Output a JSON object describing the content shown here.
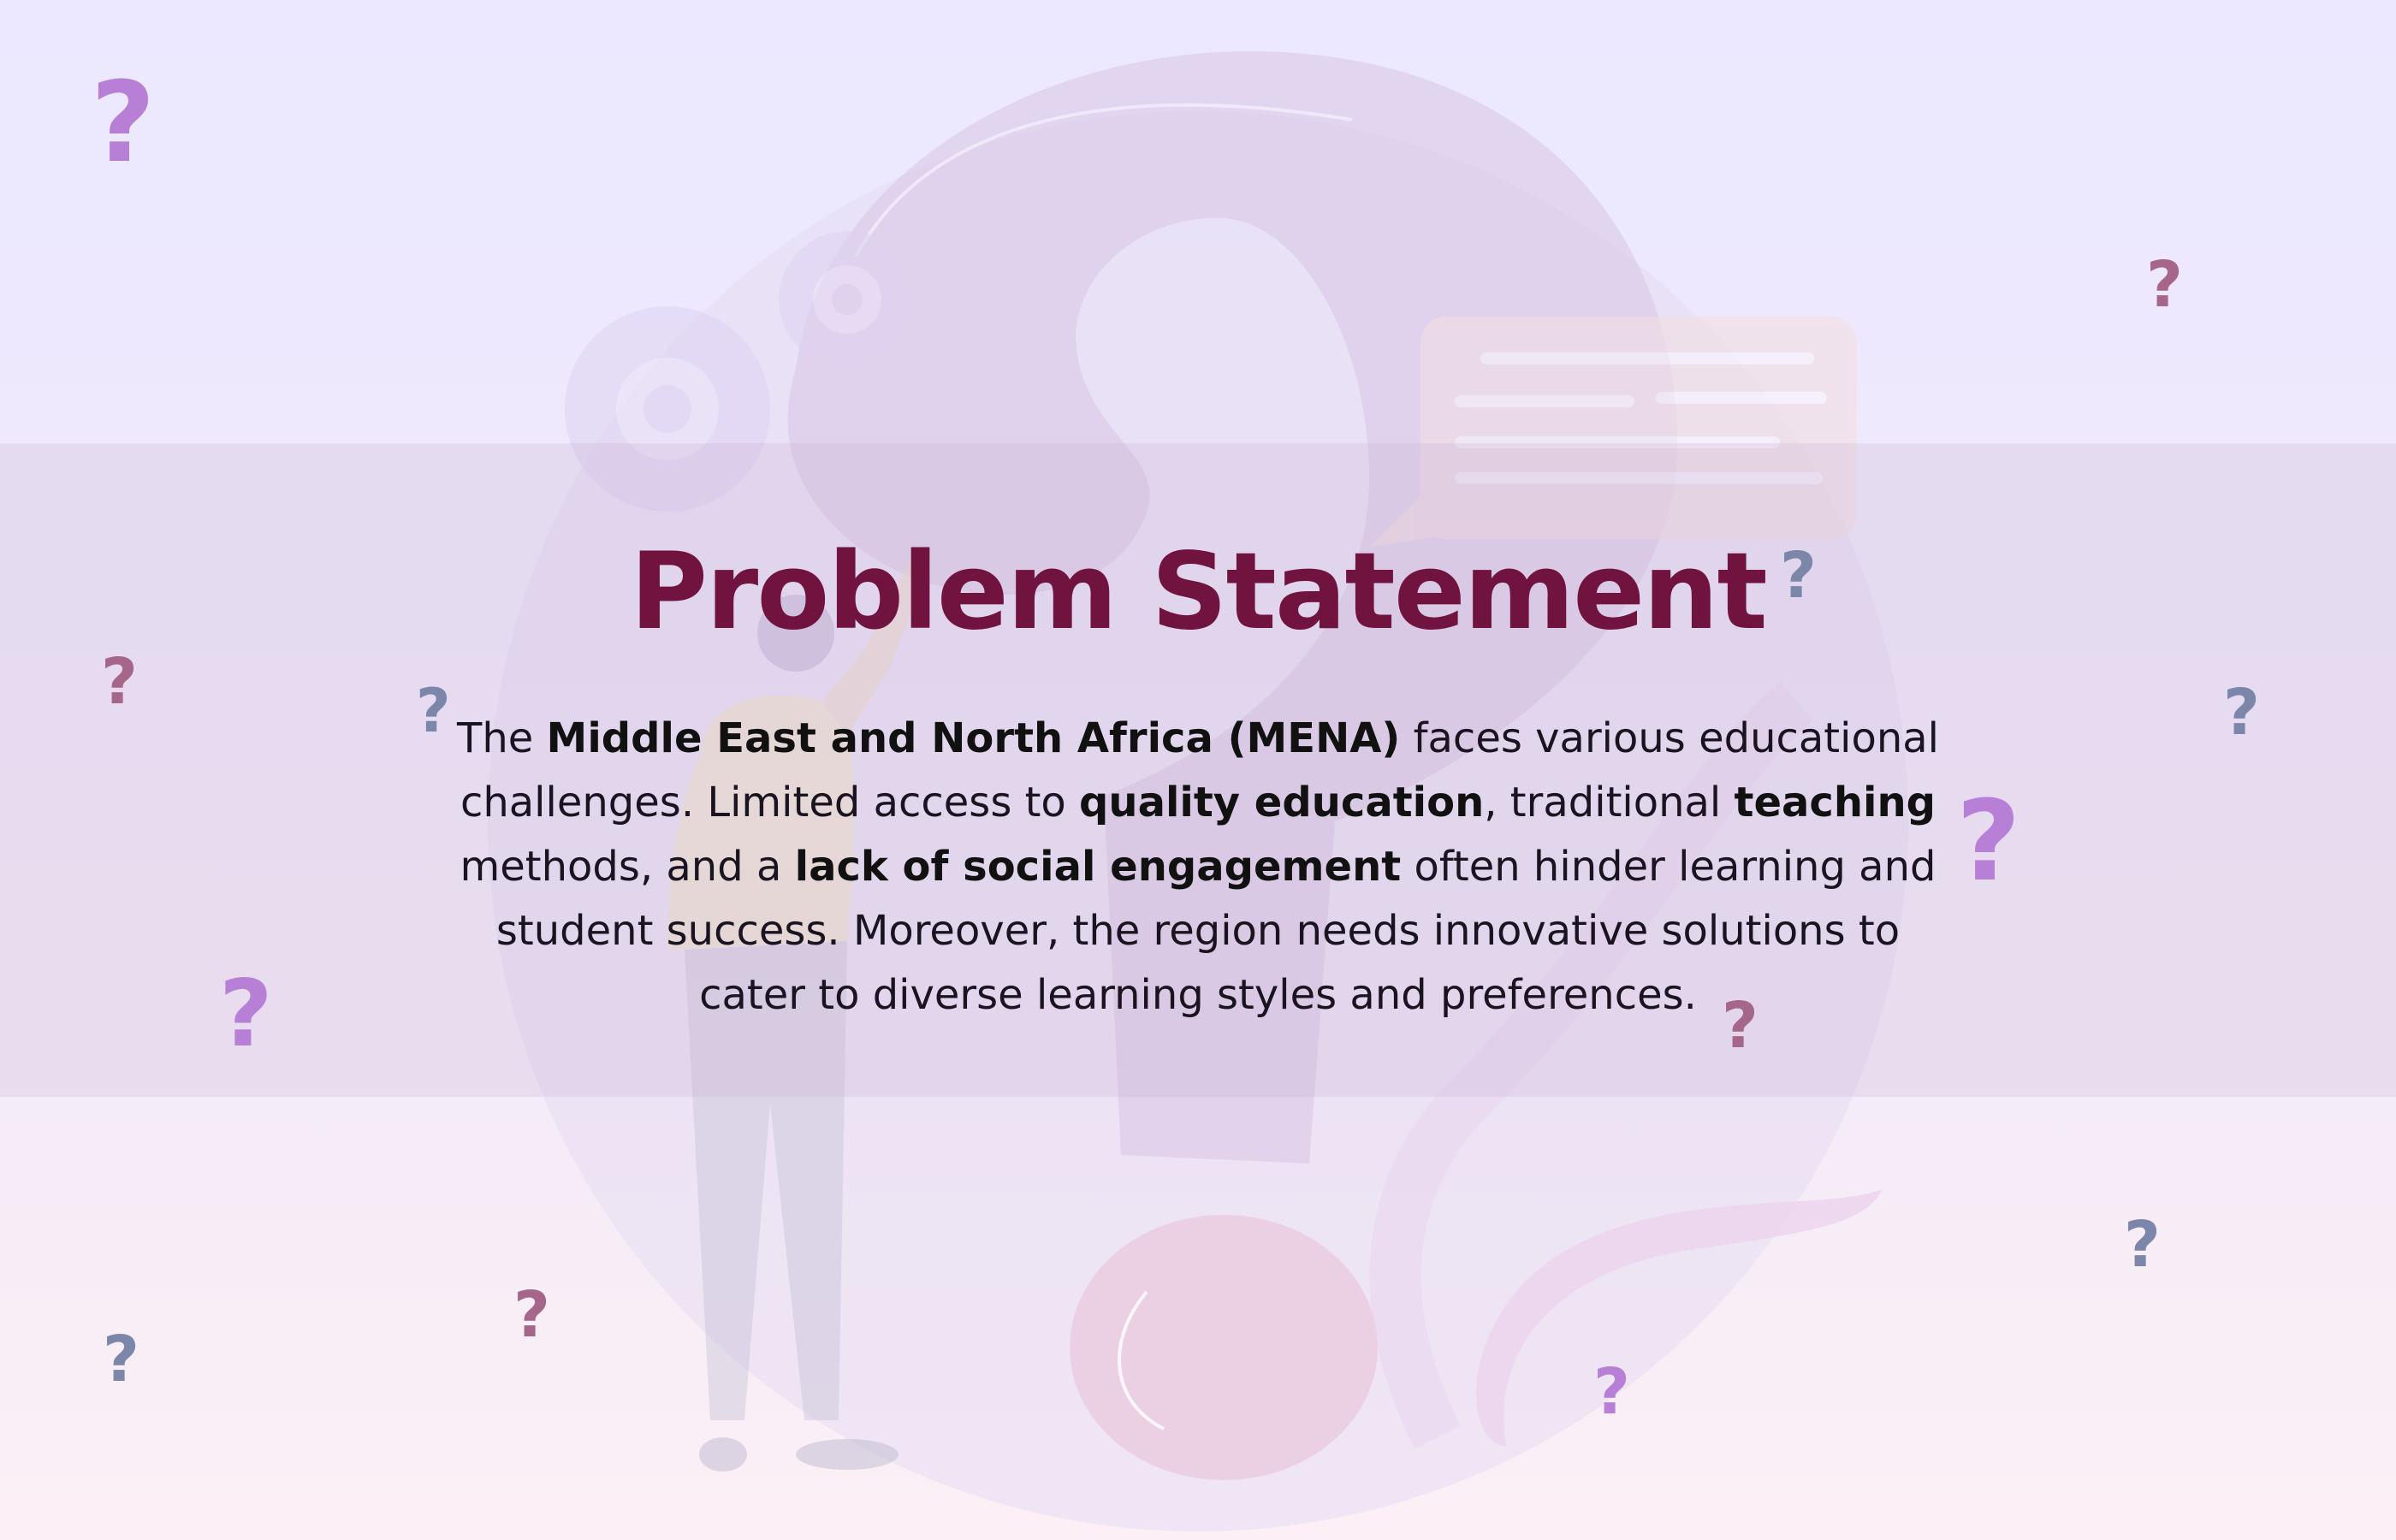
{
  "slide": {
    "title": "Problem Statement",
    "body": [
      {
        "text": "The ",
        "bold": false
      },
      {
        "text": "Middle East and North Africa (MENA)",
        "bold": true
      },
      {
        "text": " faces various educational challenges. Limited access to ",
        "bold": false
      },
      {
        "text": "quality education",
        "bold": true
      },
      {
        "text": ", traditional ",
        "bold": false
      },
      {
        "text": "teaching",
        "bold": true
      },
      {
        "text": " methods, and a ",
        "bold": false
      },
      {
        "text": "lack of social engagement",
        "bold": true
      },
      {
        "text": " often hinder learning and student success. Moreover, the region needs innovative solutions to cater to diverse learning styles and preferences.",
        "bold": false
      }
    ]
  },
  "decor": {
    "glyph": "?",
    "colors": {
      "title": "#70143f",
      "purple": "#b77fd6",
      "mauve": "#a56689",
      "slate": "#7c86a8"
    },
    "illustration": "question-mark-person-gears-speech-bubble"
  }
}
